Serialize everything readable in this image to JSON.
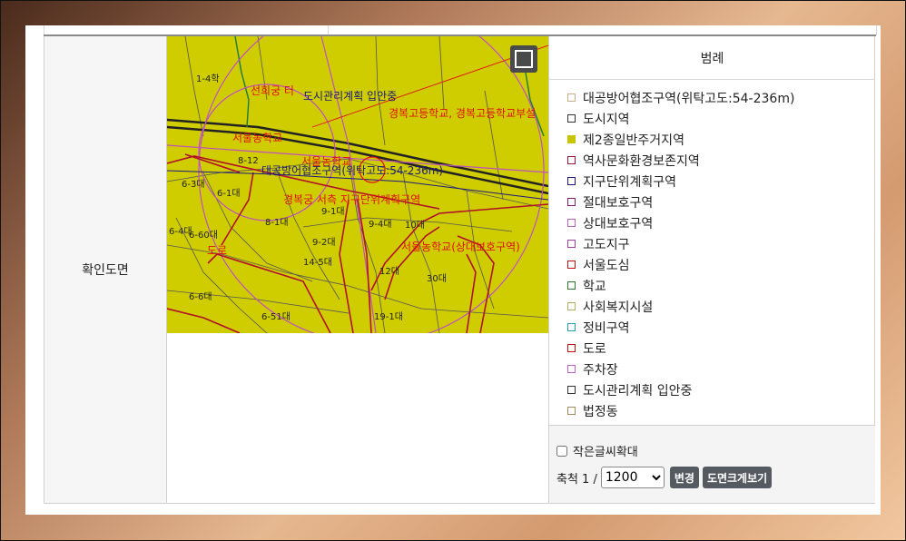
{
  "row_label": "확인도면",
  "legend": {
    "title": "범례",
    "items": [
      {
        "label": "대공방어협조구역(위탁고도:54-236m)",
        "color": "#c8b08a",
        "fill": ""
      },
      {
        "label": "도시지역",
        "color": "#333333",
        "fill": ""
      },
      {
        "label": "제2종일반주거지역",
        "color": "#c8c400",
        "fill": "#c8c400"
      },
      {
        "label": "역사문화환경보존지역",
        "color": "#a01030",
        "fill": ""
      },
      {
        "label": "지구단위계획구역",
        "color": "#1a1a80",
        "fill": ""
      },
      {
        "label": "절대보호구역",
        "color": "#8a1a6a",
        "fill": ""
      },
      {
        "label": "상대보호구역",
        "color": "#c060c0",
        "fill": ""
      },
      {
        "label": "고도지구",
        "color": "#a040a0",
        "fill": ""
      },
      {
        "label": "서울도심",
        "color": "#c01010",
        "fill": ""
      },
      {
        "label": "학교",
        "color": "#2a7a2a",
        "fill": ""
      },
      {
        "label": "사회복지시설",
        "color": "#b0b060",
        "fill": ""
      },
      {
        "label": "정비구역",
        "color": "#20a0b0",
        "fill": ""
      },
      {
        "label": "도로",
        "color": "#c01010",
        "fill": ""
      },
      {
        "label": "주차장",
        "color": "#c060c0",
        "fill": ""
      },
      {
        "label": "도시관리계획 입안중",
        "color": "#333333",
        "fill": ""
      },
      {
        "label": "법정동",
        "color": "#a08a60",
        "fill": ""
      }
    ]
  },
  "controls": {
    "small_font_label": "작은글씨확대",
    "scale_prefix": "축척 1 /",
    "scale_value": "1200",
    "change_button": "변경",
    "enlarge_button": "도면크게보기"
  },
  "map": {
    "labels": {
      "l1": "1-4학",
      "l2": "선희궁 터",
      "l3": "도시관리계획 입안중",
      "l4": "경복고등학교, 경복고등학교부설",
      "l5": "서울농학교",
      "l6": "서울농학교",
      "l7": "대공방어협조구역(위탁고도:54-236m)",
      "l8": "경복궁 서측 지구단위계획구역",
      "l9": "서울농학교(상대보호구역)",
      "l10": "도로",
      "p1": "6-3대",
      "p2": "6-1대",
      "p3": "8-1대",
      "p4": "9-1대",
      "p5": "9-4대",
      "p6": "10대",
      "p7": "9-2대",
      "p8": "14-5대",
      "p9": "12대",
      "p10": "30대",
      "p11": "6-6대",
      "p12": "6-51대",
      "p13": "19-1대",
      "p14": "8-12",
      "p15": "6-4대",
      "p16": "6-60대"
    }
  }
}
